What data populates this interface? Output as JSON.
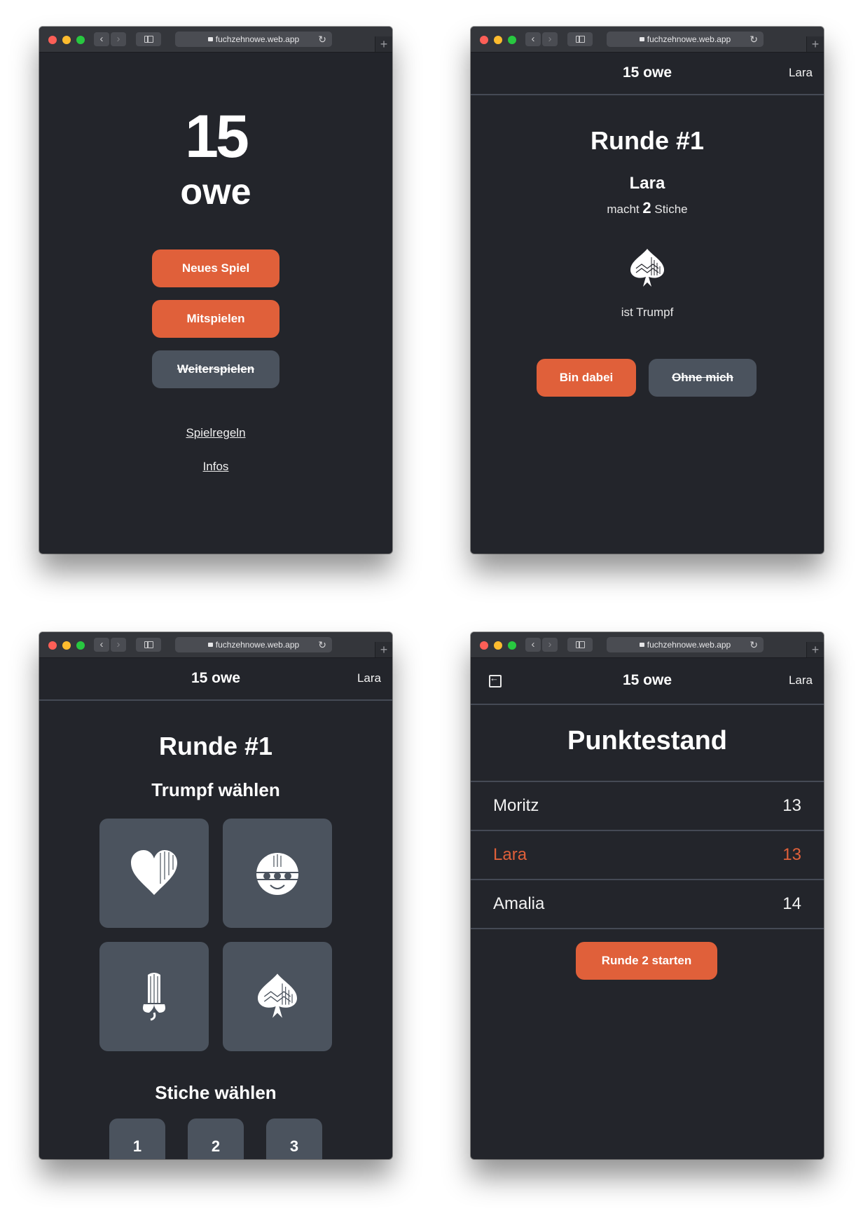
{
  "browser": {
    "url": "fuchzehnowe.web.app",
    "back_icon": "‹",
    "forward_icon": "›",
    "reload_icon": "↻",
    "newtab_icon": "+"
  },
  "home": {
    "title_line1": "15",
    "title_line2": "owe",
    "new_game": "Neues Spiel",
    "join": "Mitspielen",
    "continue": "Weiterspielen",
    "rules": "Spielregeln",
    "info": "Infos"
  },
  "app": {
    "brand": "15 owe",
    "user": "Lara"
  },
  "announce": {
    "round_title": "Runde #1",
    "player": "Lara",
    "makes_prefix": "macht",
    "tricks": "2",
    "makes_suffix": "Stiche",
    "trump_suit_icon": "leaf-icon",
    "trump_text": "ist Trumpf",
    "accept": "Bin dabei",
    "decline": "Ohne mich"
  },
  "choose": {
    "round_title": "Runde #1",
    "trump_heading": "Trumpf wählen",
    "suits": [
      "heart-icon",
      "bell-icon",
      "acorn-icon",
      "leaf-icon"
    ],
    "tricks_heading": "Stiche wählen",
    "trick_options": [
      "1",
      "2",
      "3"
    ]
  },
  "scores": {
    "title": "Punktestand",
    "rows": [
      {
        "name": "Moritz",
        "score": "13"
      },
      {
        "name": "Lara",
        "score": "13"
      },
      {
        "name": "Amalia",
        "score": "14"
      }
    ],
    "start_next": "Runde 2 starten"
  },
  "colors": {
    "accent": "#e0603a",
    "background": "#23252b",
    "button_grey": "#4b535e",
    "divider": "#454a55"
  }
}
